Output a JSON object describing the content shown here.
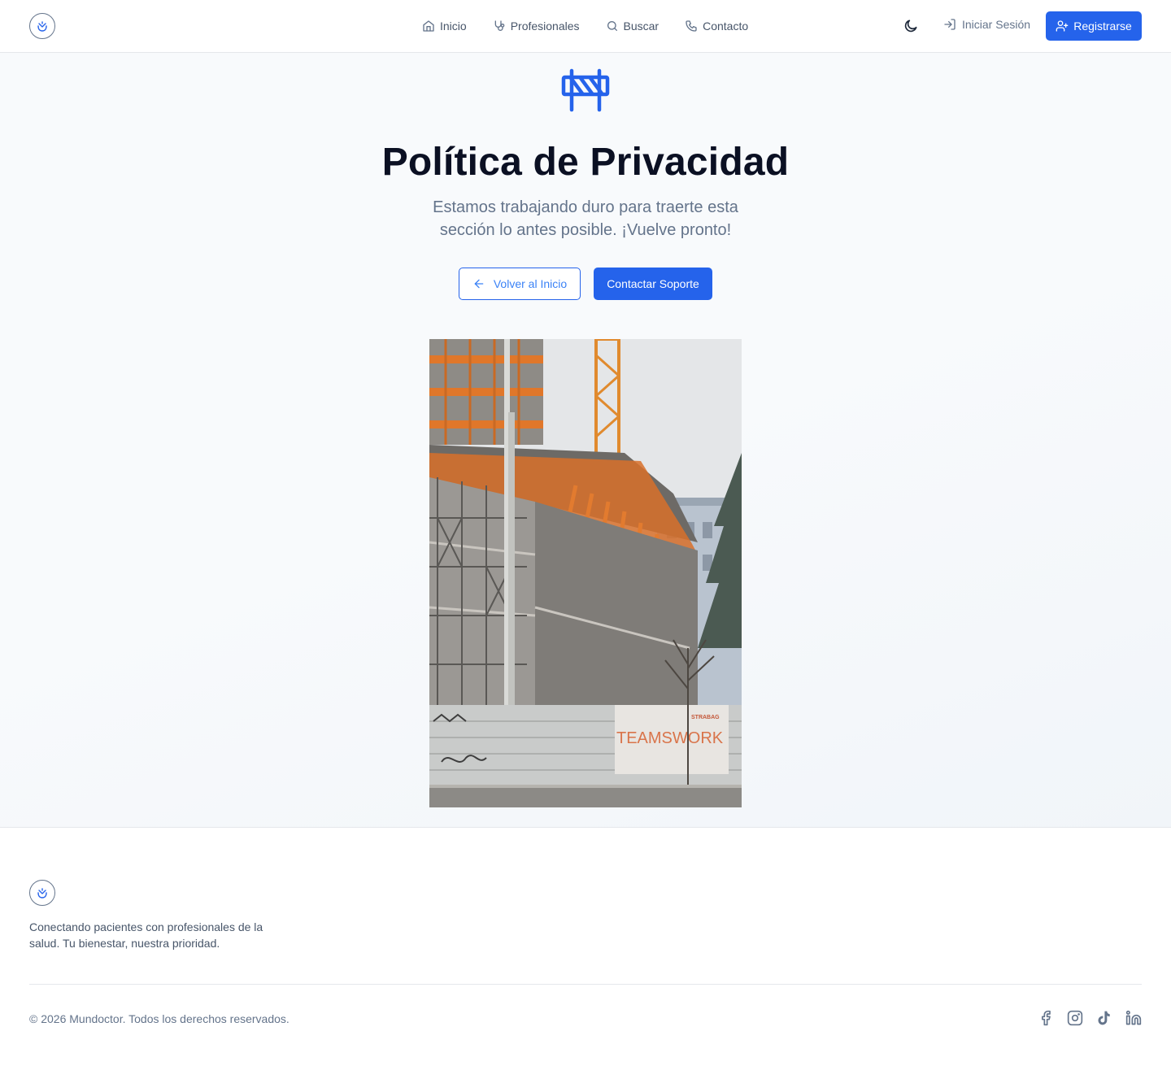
{
  "header": {
    "nav": [
      {
        "label": "Inicio",
        "icon": "home-icon"
      },
      {
        "label": "Profesionales",
        "icon": "stethoscope-icon"
      },
      {
        "label": "Buscar",
        "icon": "search-icon"
      },
      {
        "label": "Contacto",
        "icon": "phone-icon"
      }
    ],
    "login_label": "Iniciar Sesión",
    "register_label": "Registrarse"
  },
  "main": {
    "title": "Política de Privacidad",
    "subtitle": "Estamos trabajando duro para traerte esta sección lo antes posible. ¡Vuelve pronto!",
    "back_label": "Volver al Inicio",
    "support_label": "Contactar Soporte",
    "photo_sign_text": "TEAMSWORK",
    "photo_sign_brand": "STRABAG"
  },
  "footer": {
    "tagline": "Conectando pacientes con profesionales de la salud. Tu bienestar, nuestra prioridad.",
    "copyright": "© 2026 Mundoctor. Todos los derechos reservados.",
    "socials": [
      "facebook-icon",
      "instagram-icon",
      "tiktok-icon",
      "linkedin-icon"
    ]
  },
  "colors": {
    "primary": "#2563eb",
    "text_muted": "#64748b",
    "title": "#0b1023",
    "border": "#e5e7eb"
  }
}
